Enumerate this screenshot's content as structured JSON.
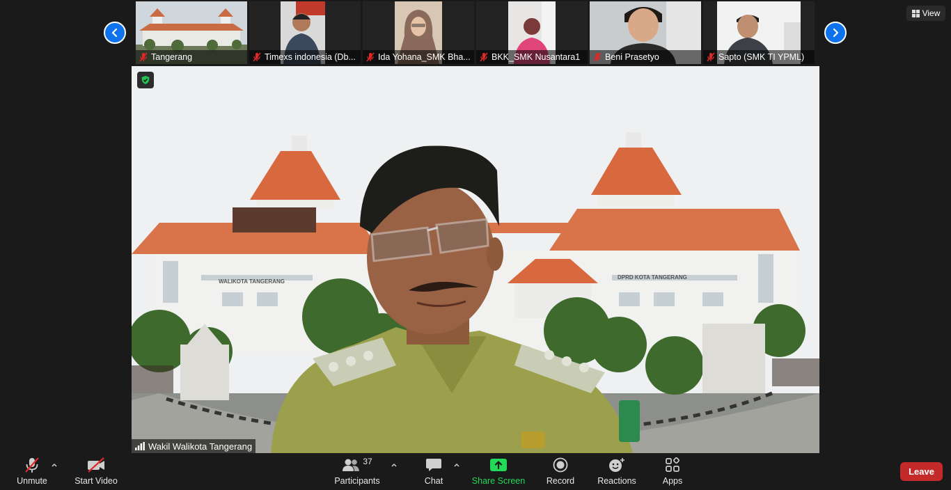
{
  "top_strip": {
    "participants": [
      {
        "name": "Tangerang"
      },
      {
        "name": "Timexs indonesia (Db..."
      },
      {
        "name": "Ida Yohana_SMK Bha..."
      },
      {
        "name": "BKK_SMK Nusantara1"
      },
      {
        "name": "Beni Prasetyo"
      },
      {
        "name": "Sapto (SMK TI YPML)"
      }
    ],
    "view_label": "View"
  },
  "main_video": {
    "speaker_name": "Wakil Walikota Tangerang",
    "building_sign_left": "WALIKOTA TANGERANG",
    "building_sign_right": "DPRD KOTA TANGERANG"
  },
  "toolbar": {
    "unmute_label": "Unmute",
    "start_video_label": "Start Video",
    "participants_label": "Participants",
    "participants_count": "37",
    "chat_label": "Chat",
    "share_screen_label": "Share Screen",
    "record_label": "Record",
    "reactions_label": "Reactions",
    "apps_label": "Apps",
    "leave_label": "Leave"
  },
  "colors": {
    "accent_blue": "#0e72ed",
    "share_green": "#23d959",
    "leave_red": "#c42a2a",
    "muted_red": "#e02828"
  }
}
